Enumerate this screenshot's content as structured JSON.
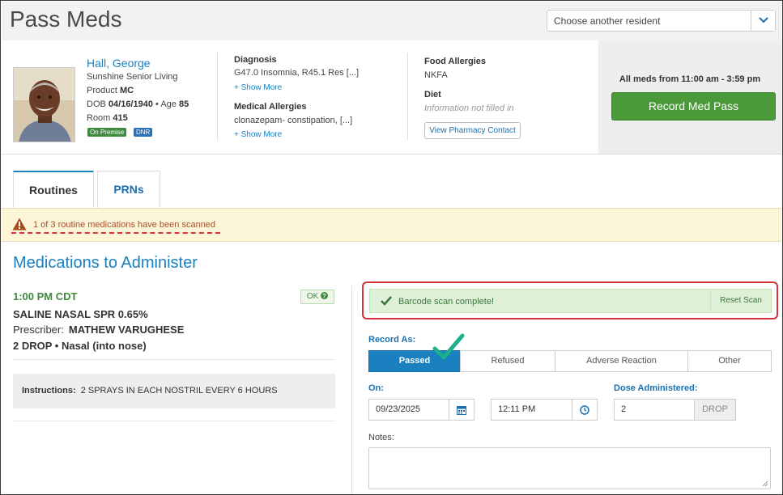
{
  "page": {
    "title": "Pass Meds",
    "resident_select_placeholder": "Choose another resident"
  },
  "resident": {
    "name": "Hall, George",
    "facility": "Sunshine Senior Living",
    "product_label": "Product",
    "product": "MC",
    "dob_label": "DOB",
    "dob": "04/16/1940",
    "age_label": "Age",
    "age": "85",
    "room_label": "Room",
    "room": "415",
    "badges": [
      "On Premise",
      "DNR"
    ]
  },
  "diagnosis": {
    "title": "Diagnosis",
    "text": "G47.0 Insomnia, R45.1 Res [...]",
    "show_more": "+ Show More"
  },
  "medical_allergies": {
    "title": "Medical Allergies",
    "text": "clonazepam- constipation, [...]",
    "show_more": "+ Show More"
  },
  "food_allergies": {
    "title": "Food Allergies",
    "text": "NKFA"
  },
  "diet": {
    "title": "Diet",
    "text": "Information not filled in"
  },
  "pharmacy_button": "View Pharmacy Contact",
  "med_pass": {
    "window": "All meds from 11:00 am - 3:59 pm",
    "record_button": "Record Med Pass"
  },
  "tabs": [
    {
      "label": "Routines",
      "active": true
    },
    {
      "label": "PRNs",
      "active": false
    }
  ],
  "alert": {
    "message": "1 of 3 routine medications have been scanned"
  },
  "section_title": "Medications to Administer",
  "medication": {
    "time": "1:00 PM CDT",
    "status": "OK",
    "name": "SALINE NASAL SPR 0.65%",
    "prescriber_label": "Prescriber:",
    "prescriber": "MATHEW VARUGHESE",
    "dose": "2 DROP",
    "route": "Nasal (into nose)",
    "instructions_label": "Instructions:",
    "instructions": "2 SPRAYS IN EACH NOSTRIL EVERY 6 HOURS"
  },
  "scan": {
    "message": "Barcode scan complete!",
    "reset": "Reset Scan"
  },
  "record_form": {
    "record_as_label": "Record As:",
    "options": [
      "Passed",
      "Refused",
      "Adverse Reaction",
      "Other"
    ],
    "selected": "Passed",
    "on_label": "On:",
    "date": "09/23/2025",
    "time": "12:11 PM",
    "dose_label": "Dose Administered:",
    "dose_value": "2",
    "dose_unit": "DROP",
    "notes_label": "Notes:"
  },
  "colors": {
    "accent_blue": "#1a80c0",
    "record_green": "#4a9a3a",
    "alert_bg": "#fcf5d8",
    "highlight_red": "#d6333b",
    "checkmark_teal": "#1db08a"
  }
}
